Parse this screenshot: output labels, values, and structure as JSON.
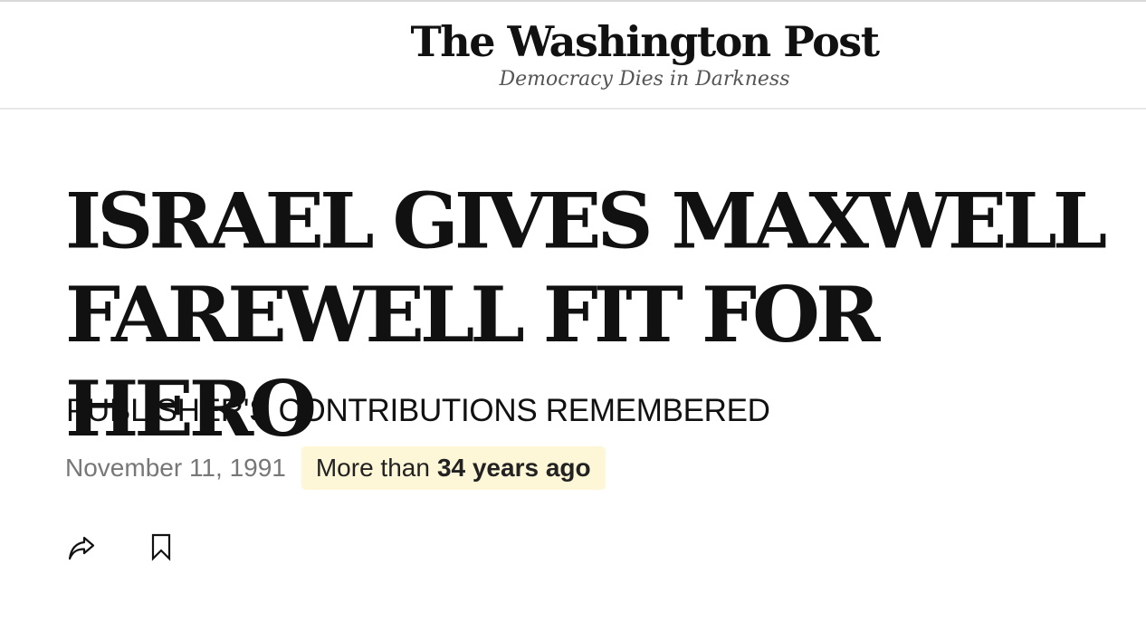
{
  "masthead": {
    "logo_text": "The Washington Post",
    "tagline": "Democracy Dies in Darkness"
  },
  "article": {
    "headline": "ISRAEL GIVES MAXWELL FAREWELL FIT FOR HERO",
    "subheadline": "PUBLISHER'S CONTRIBUTIONS REMEMBERED",
    "date": "November 11, 1991",
    "age_prefix": "More than",
    "age_value": "34 years ago"
  },
  "actions": {
    "share_icon": "share-icon",
    "bookmark_icon": "bookmark-icon"
  },
  "colors": {
    "text": "#111111",
    "date": "#777777",
    "badge_background": "#fdf6d7"
  }
}
